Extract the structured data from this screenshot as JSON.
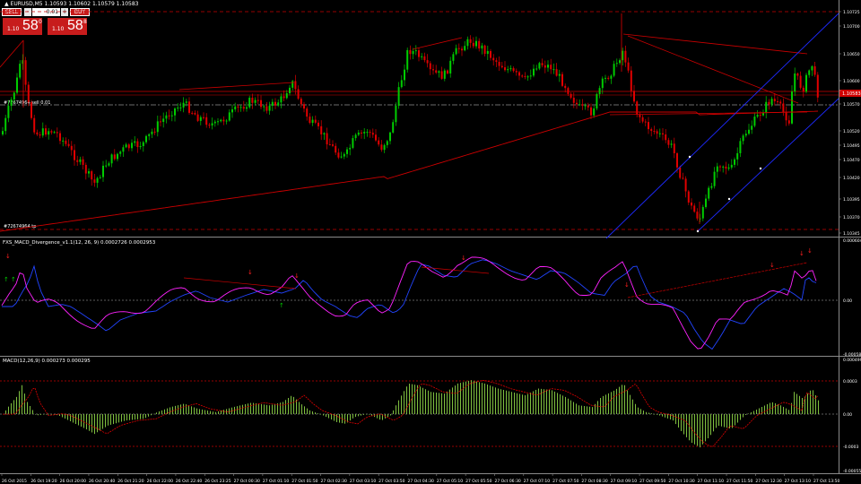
{
  "chart": {
    "symbol_title": "EURUSD,M5  1.10593 1.10602 1.10579 1.10583",
    "order_line_1": "#72674964 sell 0.01",
    "order_line_2": "#72674964 tp"
  },
  "trade_panel": {
    "sell_label": "SELL",
    "buy_label": "BUY",
    "minus": "-",
    "plus": "+",
    "lot": "0.01",
    "bid_prefix": "1.10",
    "bid_big": "58",
    "bid_sup": "0",
    "ask_prefix": "1.10",
    "ask_big": "58",
    "ask_sup": "8"
  },
  "price_axis": [
    "1.10725",
    "1.10700",
    "1.10650",
    "1.10600",
    "1.10583",
    "1.10570",
    "1.10520",
    "1.10495",
    "1.10470",
    "1.10420",
    "1.10395",
    "1.10370",
    "1.10345"
  ],
  "current_price": "1.10583",
  "indicator_1": {
    "label": "FXS_MACD_Divergence_v1.1(12, 26, 9) 0.0002726 0.0002953",
    "axis": [
      "0.000604",
      "0.00",
      "-0.000581"
    ]
  },
  "indicator_2": {
    "label": "MACD(12,26,9) 0.000273 0.000295",
    "axis": [
      "0.000499",
      "0.0003",
      "0.00",
      "-0.0003",
      "-0.000550"
    ]
  },
  "time_axis": [
    "26 Oct 2015",
    "26 Oct 19:20",
    "26 Oct 20:00",
    "26 Oct 20:40",
    "26 Oct 21:20",
    "26 Oct 22:00",
    "26 Oct 22:40",
    "26 Oct 23:25",
    "27 Oct 00:30",
    "27 Oct 01:10",
    "27 Oct 01:50",
    "27 Oct 02:30",
    "27 Oct 03:10",
    "27 Oct 03:50",
    "27 Oct 04:30",
    "27 Oct 05:10",
    "27 Oct 05:50",
    "27 Oct 06:30",
    "27 Oct 07:10",
    "27 Oct 07:50",
    "27 Oct 08:30",
    "27 Oct 09:10",
    "27 Oct 09:50",
    "27 Oct 10:30",
    "27 Oct 11:10",
    "27 Oct 11:50",
    "27 Oct 12:30",
    "27 Oct 13:10",
    "27 Oct 13:50"
  ],
  "colors": {
    "bull": "#00cc00",
    "bear": "#e00000",
    "ma": "#cc0000",
    "channel": "#1e2aff",
    "macd_main": "#ff22ff",
    "macd_signal": "#2244ff",
    "hist": "#7fbf3f",
    "arrow": "#ff2020",
    "arrow_up": "#00cc00"
  }
}
